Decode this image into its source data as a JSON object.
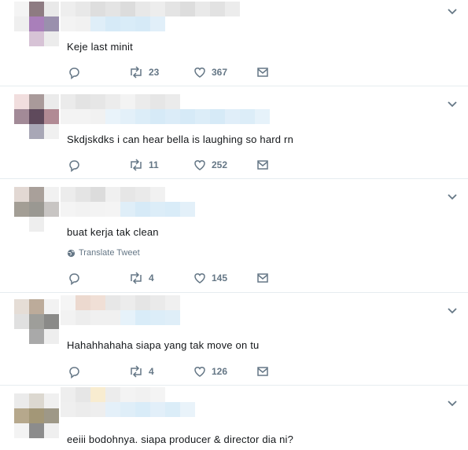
{
  "tweets": [
    {
      "text": "Keje last minit",
      "retweets": "23",
      "likes": "367",
      "translate": ""
    },
    {
      "text": "Skdjskdks i can hear bella is laughing so hard rn",
      "retweets": "11",
      "likes": "252",
      "translate": ""
    },
    {
      "text": "buat kerja tak clean",
      "retweets": "4",
      "likes": "145",
      "translate": "Translate Tweet"
    },
    {
      "text": "Hahahhahaha siapa yang tak move on tu",
      "retweets": "4",
      "likes": "126",
      "translate": ""
    },
    {
      "text": "eeiii bodohnya. siapa producer & director dia ni?",
      "retweets": "",
      "likes": "",
      "translate": ""
    }
  ],
  "icons": {
    "reply": "reply-icon",
    "retweet": "retweet-icon",
    "like": "heart-icon",
    "message": "envelope-icon",
    "menu": "chevron-down-icon",
    "translate": "globe-icon"
  },
  "colors": {
    "muted": "#657786",
    "divider": "#e6ecf0",
    "link_blur": "#d6eaf7"
  }
}
